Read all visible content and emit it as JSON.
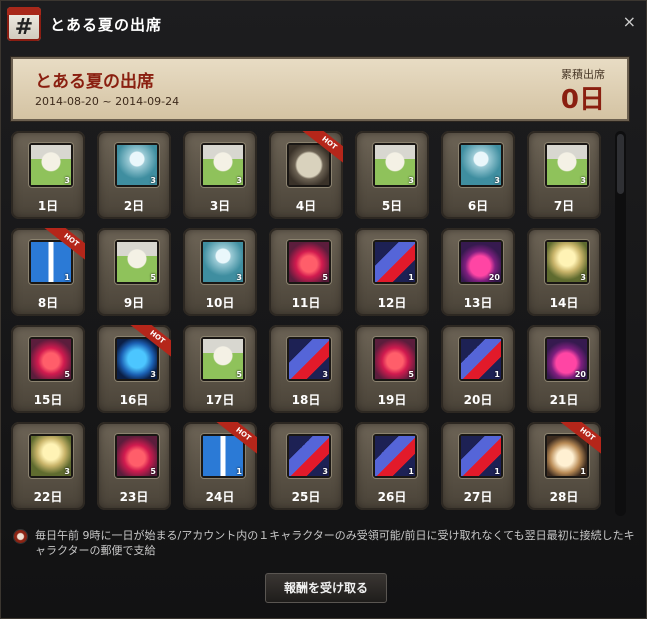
{
  "window": {
    "title": "とある夏の出席",
    "icon": "calendar-icon",
    "icon_text": "#",
    "close_text": "×"
  },
  "event": {
    "name": "とある夏の出席",
    "date_range": "2014-08-20 ~ 2014-09-24",
    "accumulated_label": "累積出席",
    "accumulated_value": "0日"
  },
  "notice": {
    "text": "毎日午前 9時に一日が始まる/アカウント内の１キャラクターのみ受領可能/前日に受け取れなくても翌日最初に接続したキャラクターの郵便で支給",
    "icon": "notice-icon"
  },
  "claim_button": {
    "label": "報酬を受け取る"
  },
  "hot_label": "HOT",
  "days": [
    {
      "day": "1日",
      "qty": "3",
      "icon": "jar-icon",
      "hot": false
    },
    {
      "day": "2日",
      "qty": "3",
      "icon": "angel-icon",
      "hot": false
    },
    {
      "day": "3日",
      "qty": "3",
      "icon": "jar-icon",
      "hot": false
    },
    {
      "day": "4日",
      "qty": "",
      "icon": "scroll-icon",
      "hot": true
    },
    {
      "day": "5日",
      "qty": "3",
      "icon": "jar-icon",
      "hot": false
    },
    {
      "day": "6日",
      "qty": "3",
      "icon": "angel-icon",
      "hot": false
    },
    {
      "day": "7日",
      "qty": "3",
      "icon": "jar-icon",
      "hot": false
    },
    {
      "day": "8日",
      "qty": "1",
      "icon": "gift-icon",
      "hot": true
    },
    {
      "day": "9日",
      "qty": "5",
      "icon": "jar-icon",
      "hot": false
    },
    {
      "day": "10日",
      "qty": "3",
      "icon": "angel-icon",
      "hot": false
    },
    {
      "day": "11日",
      "qty": "5",
      "icon": "potion-icon",
      "hot": false
    },
    {
      "day": "12日",
      "qty": "1",
      "icon": "pill-icon",
      "hot": false
    },
    {
      "day": "13日",
      "qty": "20",
      "icon": "bottle-icon",
      "hot": false
    },
    {
      "day": "14日",
      "qty": "3",
      "icon": "golden-angel-icon",
      "hot": false
    },
    {
      "day": "15日",
      "qty": "5",
      "icon": "potion-icon",
      "hot": false
    },
    {
      "day": "16日",
      "qty": "3",
      "icon": "gem-icon",
      "hot": true
    },
    {
      "day": "17日",
      "qty": "5",
      "icon": "jar-icon",
      "hot": false
    },
    {
      "day": "18日",
      "qty": "3",
      "icon": "pill-icon",
      "hot": false
    },
    {
      "day": "19日",
      "qty": "5",
      "icon": "potion-icon",
      "hot": false
    },
    {
      "day": "20日",
      "qty": "1",
      "icon": "pill-icon",
      "hot": false
    },
    {
      "day": "21日",
      "qty": "20",
      "icon": "bottle-icon",
      "hot": false
    },
    {
      "day": "22日",
      "qty": "3",
      "icon": "golden-angel-icon",
      "hot": false
    },
    {
      "day": "23日",
      "qty": "5",
      "icon": "potion-icon",
      "hot": false
    },
    {
      "day": "24日",
      "qty": "1",
      "icon": "gift-icon",
      "hot": true
    },
    {
      "day": "25日",
      "qty": "3",
      "icon": "pill-icon",
      "hot": false
    },
    {
      "day": "26日",
      "qty": "1",
      "icon": "pill-icon",
      "hot": false
    },
    {
      "day": "27日",
      "qty": "1",
      "icon": "pill-icon",
      "hot": false
    },
    {
      "day": "28日",
      "qty": "1",
      "icon": "shell-icon",
      "hot": true
    }
  ]
}
